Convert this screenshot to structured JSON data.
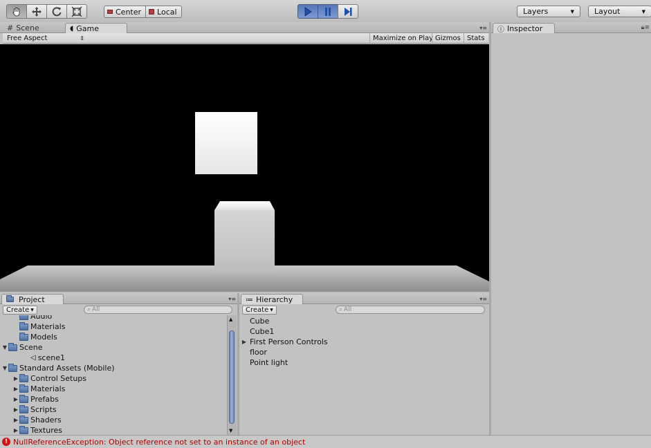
{
  "toolbar": {
    "tools": [
      "hand-icon",
      "move-icon",
      "rotate-icon",
      "scale-icon"
    ],
    "pivot_center": "Center",
    "pivot_local": "Local",
    "layers_label": "Layers",
    "layout_label": "Layout"
  },
  "tabs": {
    "scene": "Scene",
    "game": "Game",
    "inspector": "Inspector",
    "project": "Project",
    "hierarchy": "Hierarchy"
  },
  "game_controls": {
    "aspect": "Free Aspect",
    "maximize": "Maximize on Play",
    "gizmos": "Gizmos",
    "stats": "Stats"
  },
  "project": {
    "create_label": "Create",
    "search_placeholder": "All",
    "items": [
      {
        "label": "Audio",
        "indent": 1,
        "arrow": "",
        "icon": "folder"
      },
      {
        "label": "Materials",
        "indent": 1,
        "arrow": "",
        "icon": "folder"
      },
      {
        "label": "Models",
        "indent": 1,
        "arrow": "",
        "icon": "folder"
      },
      {
        "label": "Scene",
        "indent": 0,
        "arrow": "down",
        "icon": "folder"
      },
      {
        "label": "scene1",
        "indent": 2,
        "arrow": "",
        "icon": "scene"
      },
      {
        "label": "Standard Assets (Mobile)",
        "indent": 0,
        "arrow": "down",
        "icon": "folder"
      },
      {
        "label": "Control Setups",
        "indent": 1,
        "arrow": "right",
        "icon": "folder"
      },
      {
        "label": "Materials",
        "indent": 1,
        "arrow": "right",
        "icon": "folder"
      },
      {
        "label": "Prefabs",
        "indent": 1,
        "arrow": "right",
        "icon": "folder"
      },
      {
        "label": "Scripts",
        "indent": 1,
        "arrow": "right",
        "icon": "folder"
      },
      {
        "label": "Shaders",
        "indent": 1,
        "arrow": "right",
        "icon": "folder"
      },
      {
        "label": "Textures",
        "indent": 1,
        "arrow": "right",
        "icon": "folder"
      }
    ]
  },
  "hierarchy": {
    "create_label": "Create",
    "search_placeholder": "All",
    "items": [
      {
        "label": "Cube",
        "arrow": ""
      },
      {
        "label": "Cube1",
        "arrow": ""
      },
      {
        "label": "First Person Controls",
        "arrow": "right"
      },
      {
        "label": "floor",
        "arrow": ""
      },
      {
        "label": "Point light",
        "arrow": ""
      }
    ]
  },
  "status": {
    "message": "NullReferenceException: Object reference not set to an instance of an object"
  },
  "colors": {
    "play_blue": "#5d7fc0",
    "error_red": "#b00000"
  }
}
